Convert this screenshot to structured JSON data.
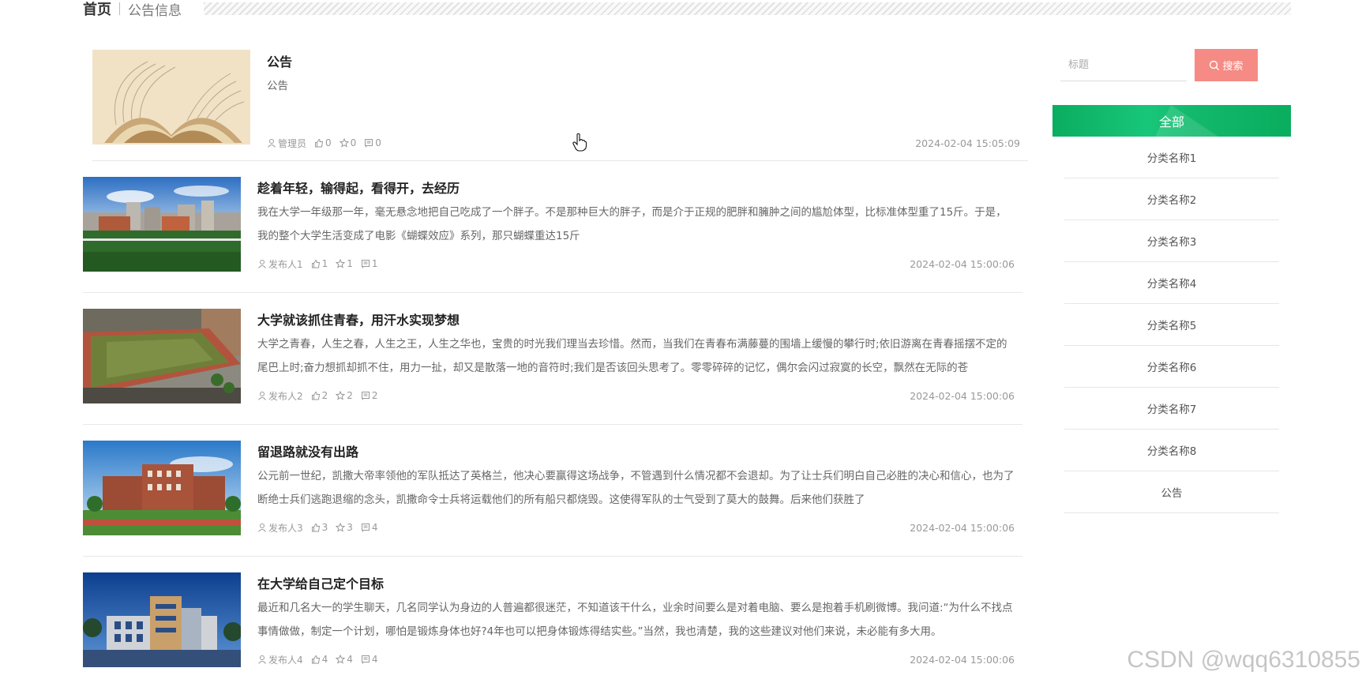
{
  "breadcrumb": {
    "home": "首页",
    "current": "公告信息"
  },
  "search": {
    "placeholder": "标题",
    "button": "搜索"
  },
  "categories": {
    "header": "全部",
    "items": [
      "分类名称1",
      "分类名称2",
      "分类名称3",
      "分类名称4",
      "分类名称5",
      "分类名称6",
      "分类名称7",
      "分类名称8",
      "公告"
    ]
  },
  "articles": [
    {
      "title": "公告",
      "desc": "公告",
      "author": "管理员",
      "likes": "0",
      "favs": "0",
      "comments": "0",
      "date": "2024-02-04 15:05:09",
      "image": "book"
    },
    {
      "title": "趁着年轻，输得起，看得开，去经历",
      "desc": "我在大学一年级那一年，毫无悬念地把自己吃成了一个胖子。不是那种巨大的胖子，而是介于正规的肥胖和臃肿之间的尴尬体型，比标准体型重了15斤。于是，我的整个大学生活变成了电影《蝴蝶效应》系列，那只蝴蝶重达15斤",
      "author": "发布人1",
      "likes": "1",
      "favs": "1",
      "comments": "1",
      "date": "2024-02-04 15:00:06",
      "image": "campus-field"
    },
    {
      "title": "大学就该抓住青春，用汗水实现梦想",
      "desc": "大学之青春，人生之春，人生之王，人生之华也，宝贵的时光我们理当去珍惜。然而，当我们在青春布满藤蔓的围墙上缓慢的攀行时;依旧游离在青春摇摆不定的尾巴上时;奋力想抓却抓不住，用力一扯，却又是散落一地的音符时;我们是否该回头思考了。零零碎碎的记忆，偶尔会闪过寂寞的长空，飘然在无际的苍",
      "author": "发布人2",
      "likes": "2",
      "favs": "2",
      "comments": "2",
      "date": "2024-02-04 15:00:06",
      "image": "stadium"
    },
    {
      "title": "留退路就没有出路",
      "desc": "公元前一世纪，凯撒大帝率领他的军队抵达了英格兰，他决心要赢得这场战争，不管遇到什么情况都不会退却。为了让士兵们明白自己必胜的决心和信心，也为了断绝士兵们逃跑退缩的念头，凯撒命令士兵将运载他们的所有船只都烧毁。这使得军队的士气受到了莫大的鼓舞。后来他们获胜了",
      "author": "发布人3",
      "likes": "3",
      "favs": "3",
      "comments": "4",
      "date": "2024-02-04 15:00:06",
      "image": "brick-building"
    },
    {
      "title": "在大学给自己定个目标",
      "desc": "最近和几名大一的学生聊天，几名同学认为身边的人普遍都很迷茫，不知道该干什么，业余时间要么是对着电脑、要么是抱着手机刷微博。我问道:“为什么不找点事情做做，制定一个计划，哪怕是锻炼身体也好?4年也可以把身体锻炼得结实些。”当然，我也清楚，我的这些建议对他们来说，未必能有多大用。",
      "author": "发布人4",
      "likes": "4",
      "favs": "4",
      "comments": "4",
      "date": "2024-02-04 15:00:06",
      "image": "modern-building"
    }
  ],
  "watermark": "CSDN @wqq6310855"
}
